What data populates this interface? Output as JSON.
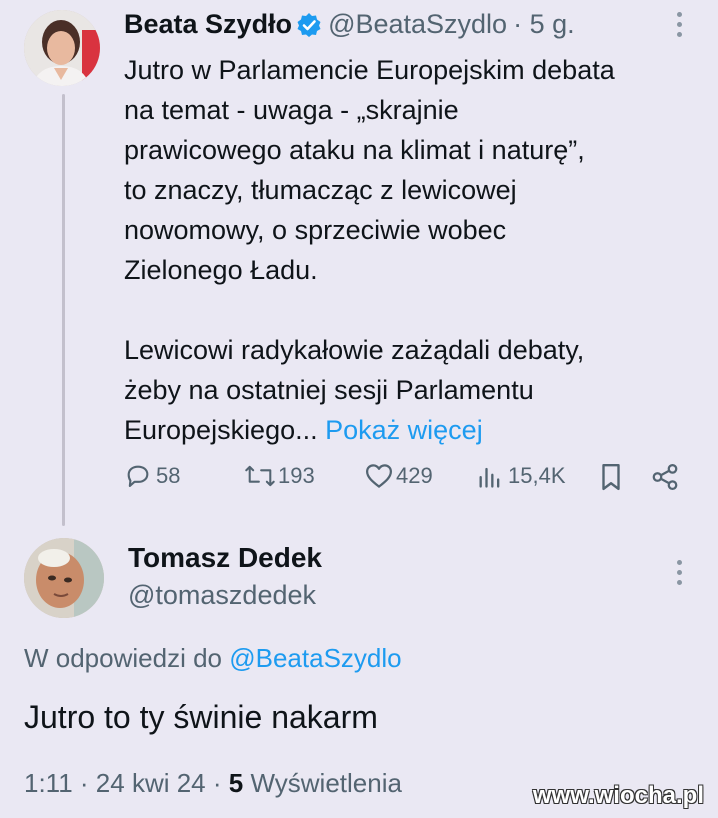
{
  "tweet": {
    "author_name": "Beata Szydło",
    "author_handle": "@BeataSzydlo",
    "time_ago": "· 5 g.",
    "text": "Jutro w Parlamencie Europejskim debata\nna temat - uwaga - „skrajnie\nprawicowego ataku na klimat i naturę”,\nto znaczy, tłumacząc z lewicowej\nnowomowy, o sprzeciwie wobec\nZielonego Ładu.\n\nLewicowi radykałowie zażądali debaty,\nżeby na ostatniej sesji Parlamentu\nEuropejskiego... ",
    "show_more": "Pokaż więcej",
    "replies": "58",
    "retweets": "193",
    "likes": "429",
    "views": "15,4K"
  },
  "reply": {
    "author_name": "Tomasz Dedek",
    "author_handle": "@tomaszdedek",
    "replying_prefix": "W odpowiedzi do",
    "replying_to": "@BeataSzydlo",
    "text": "Jutro to ty świnie nakarm",
    "time": "1:11",
    "date": "· 24 kwi 24 ·",
    "views_count": "5",
    "views_label": "Wyświetlenia"
  },
  "watermark": "www.wiocha.pl",
  "icons": [
    "verified-badge-icon",
    "more-options-icon",
    "reply-icon",
    "retweet-icon",
    "like-icon",
    "views-icon",
    "bookmark-icon",
    "share-icon"
  ],
  "colors": {
    "background": "#eae8f3",
    "link": "#1d9bf0",
    "muted": "#536471",
    "text": "#0f1419"
  }
}
